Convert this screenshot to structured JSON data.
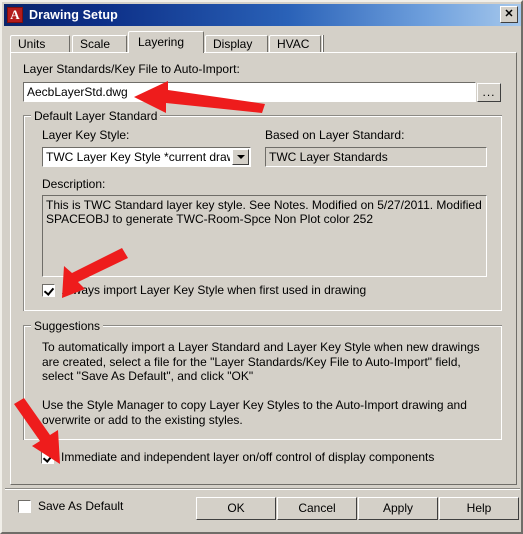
{
  "window": {
    "title": "Drawing Setup",
    "icon": "autocad-a-icon",
    "icon_glyph": "A",
    "close_label": "✕",
    "titlebar_gradient_start": "#0a246a",
    "titlebar_gradient_end": "#a6c8ec",
    "face_color": "#d4d0c8"
  },
  "tabs": [
    {
      "label": "Units",
      "active": false
    },
    {
      "label": "Scale",
      "active": false
    },
    {
      "label": "Layering",
      "active": true
    },
    {
      "label": "Display",
      "active": false
    },
    {
      "label": "HVAC",
      "active": false
    }
  ],
  "layering": {
    "auto_import_label": "Layer Standards/Key File to Auto-Import:",
    "auto_import_value": "AecbLayerStd.dwg",
    "browse_button_label": "...",
    "default_layer_standard": {
      "group_title": "Default Layer Standard",
      "layer_key_style_label": "Layer Key Style:",
      "layer_key_style_value": "TWC Layer Key Style *current drawing",
      "based_on_label": "Based on Layer Standard:",
      "based_on_value": "TWC Layer Standards",
      "description_label": "Description:",
      "description_value": "This is TWC Standard layer key style. See Notes. Modified on 5/27/2011. Modified SPACEOBJ to generate TWC-Room-Spce Non Plot color 252",
      "always_import_checkbox_label": "Always import Layer Key Style when first used in drawing",
      "always_import_checked": true
    },
    "suggestions": {
      "group_title": "Suggestions",
      "paragraph_1": "To automatically import a Layer Standard and Layer Key Style when new drawings are created, select a file for the \"Layer Standards/Key File to Auto-Import\" field, select \"Save As Default\", and click \"OK\"",
      "paragraph_2": "Use the Style Manager to copy Layer Key Styles to the Auto-Import drawing and overwrite or add to the existing styles."
    },
    "immediate_checkbox_label": "Immediate and independent layer on/off control of display components",
    "immediate_checked": true
  },
  "footer": {
    "save_as_default_label": "Save As Default",
    "save_as_default_checked": false,
    "buttons": [
      {
        "label": "OK"
      },
      {
        "label": "Cancel"
      },
      {
        "label": "Apply"
      },
      {
        "label": "Help"
      }
    ]
  },
  "annotations": {
    "color": "#ee1c1c",
    "arrows": [
      {
        "name": "arrow-to-auto-import-field",
        "direction": "left"
      },
      {
        "name": "arrow-to-always-import-checkbox",
        "direction": "down-left"
      },
      {
        "name": "arrow-to-immediate-checkbox",
        "direction": "down"
      }
    ]
  }
}
